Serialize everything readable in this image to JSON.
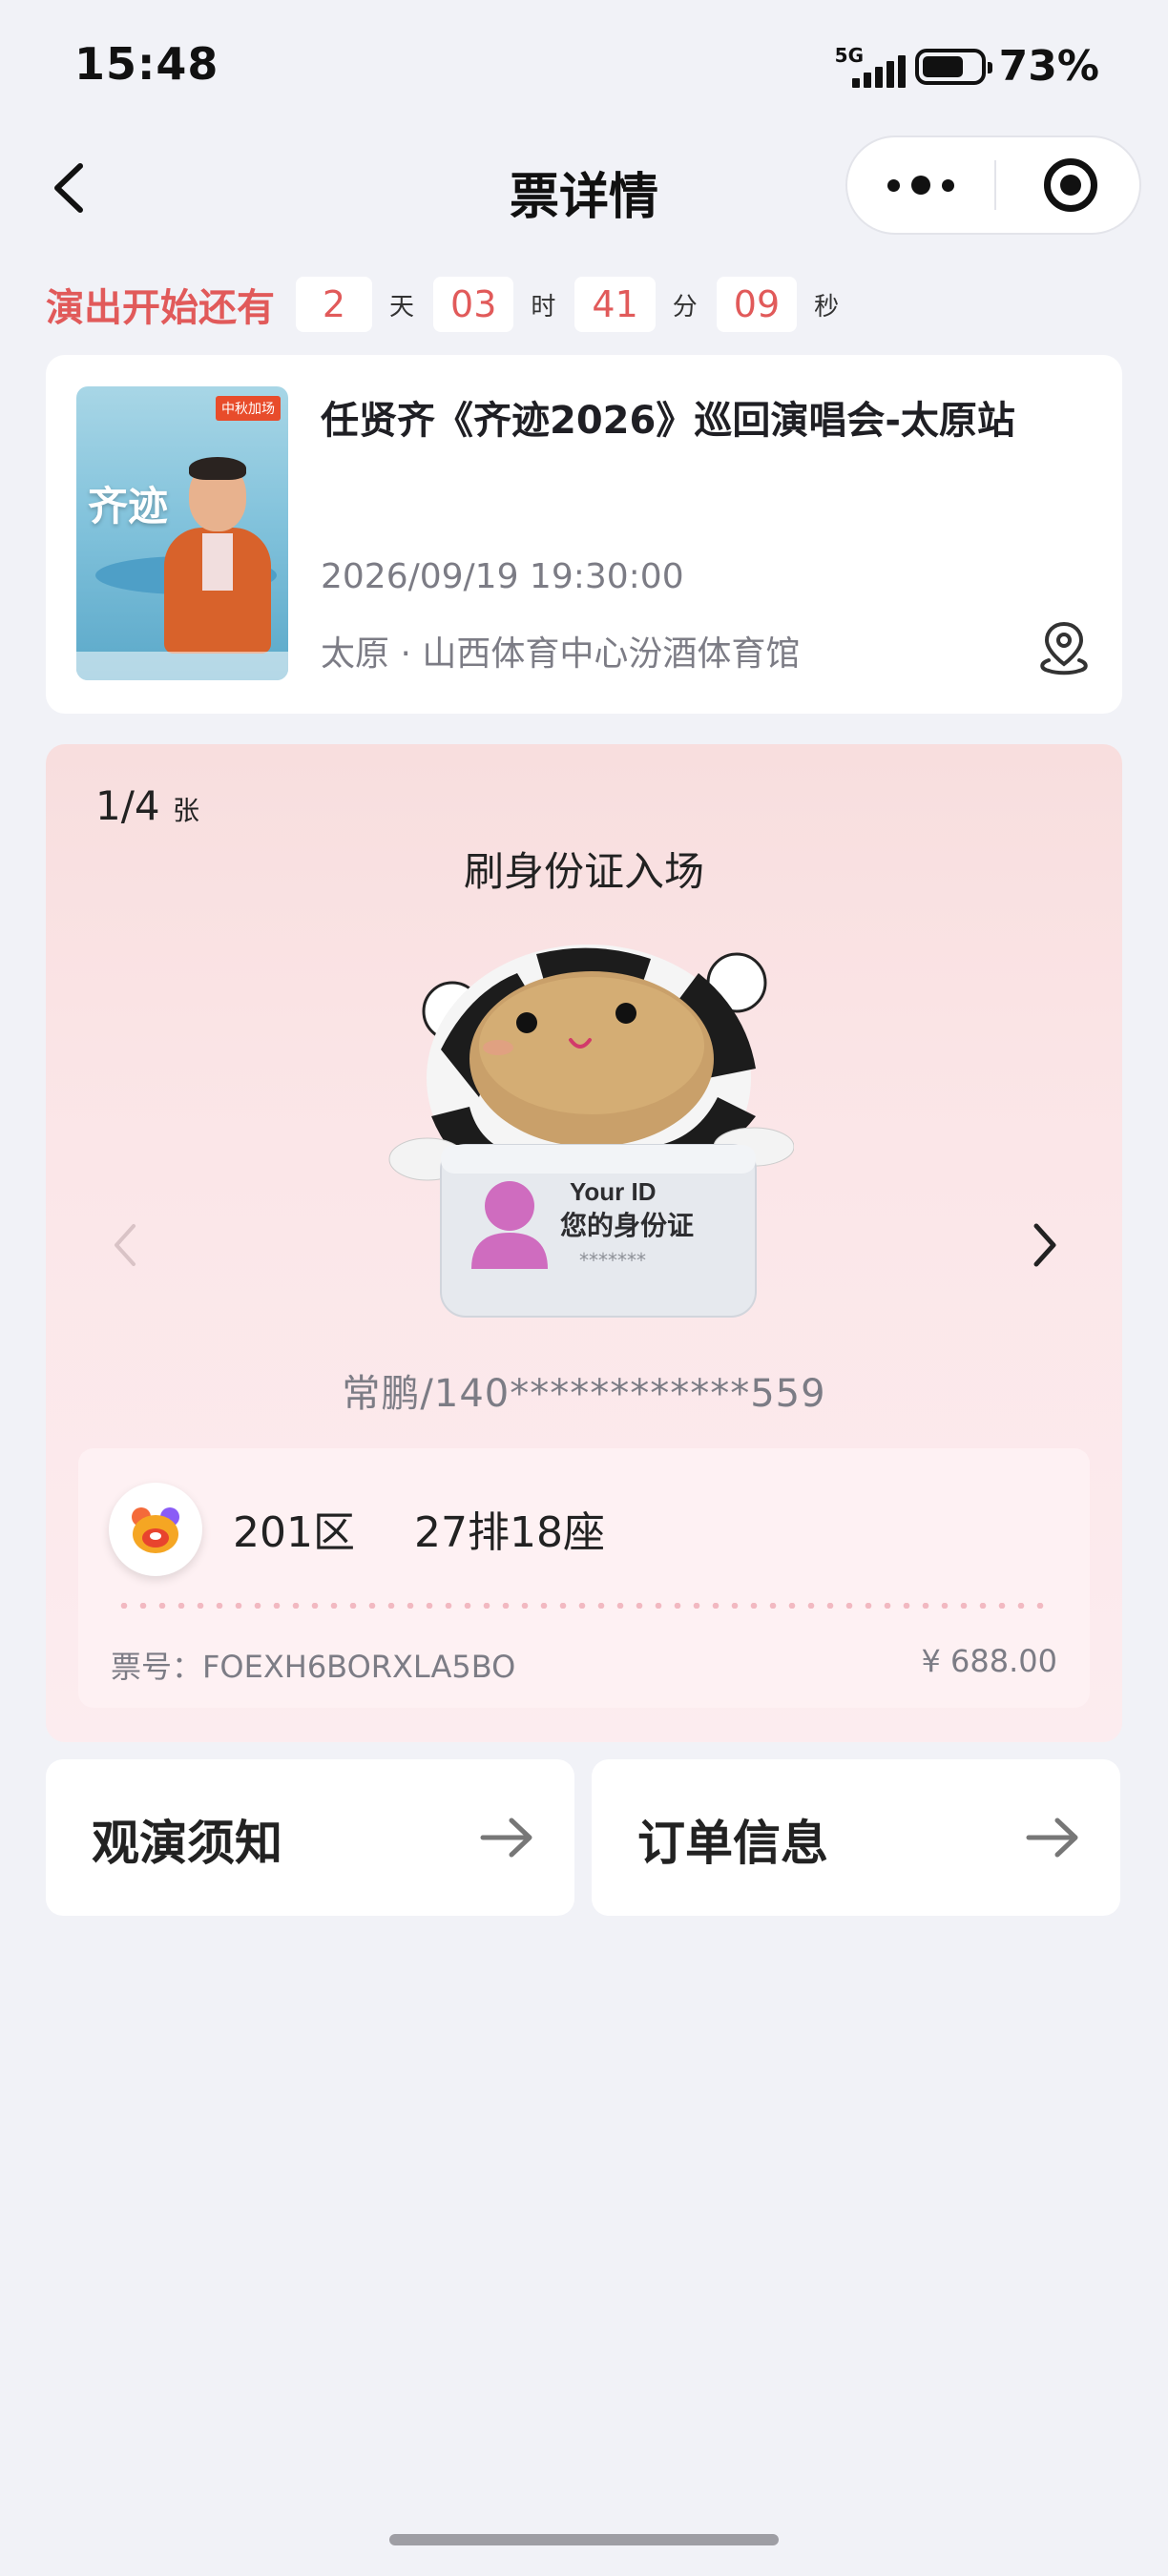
{
  "status_bar": {
    "time": "15:48",
    "network": "5G",
    "battery_text": "73%",
    "battery_level": 0.73
  },
  "nav": {
    "title": "票详情",
    "back_icon": "chevron-left-icon",
    "more_icon": "more-dots-icon",
    "close_icon": "target-icon"
  },
  "countdown": {
    "label": "演出开始还有",
    "days": "2",
    "days_unit": "天",
    "hours": "03",
    "hours_unit": "时",
    "minutes": "41",
    "minutes_unit": "分",
    "seconds": "09",
    "seconds_unit": "秒"
  },
  "event": {
    "name": "任贤齐《齐迹2026》巡回演唱会-太原站",
    "datetime": "2026/09/19 19:30:00",
    "venue": "太原 · 山西体育中心汾酒体育馆",
    "poster": {
      "tag": "中秋加场",
      "title": "齐迹"
    },
    "location_icon": "location-pin-icon"
  },
  "ticket": {
    "index": "1/4",
    "count_unit": "张",
    "entry_method": "刷身份证入场",
    "id_card": {
      "title": "Your ID",
      "subtitle": "您的身份证",
      "mask": "*******"
    },
    "holder": "常鹏/140************559",
    "seat_area": "201区",
    "seat_detail": "27排18座",
    "ticket_no_label": "票号：",
    "ticket_no": "FOEXH6BORXLA5BO",
    "price": "¥ 688.00"
  },
  "actions": {
    "notice_label": "观演须知",
    "order_label": "订单信息"
  },
  "colors": {
    "accent": "#e15a5a",
    "background": "#f1f2f7",
    "panel": "#f8dede"
  }
}
